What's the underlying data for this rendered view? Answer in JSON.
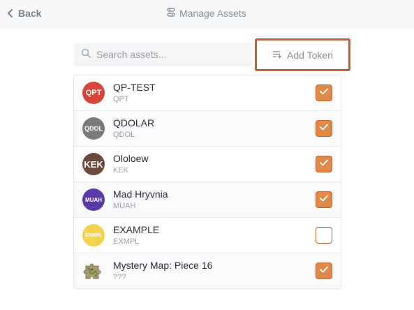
{
  "header": {
    "back_label": "Back",
    "title": "Manage Assets"
  },
  "search": {
    "placeholder": "Search assets...",
    "value": ""
  },
  "add_token": {
    "label": "Add Token"
  },
  "colors": {
    "accent": "#c4602d",
    "checkbox_fill": "#e08a4a"
  },
  "assets": [
    {
      "name": "QP-TEST",
      "symbol": "QPT",
      "avatar_text": "QPT",
      "avatar_color": "#d8453b",
      "checked": true
    },
    {
      "name": "QDOLAR",
      "symbol": "QDOL",
      "avatar_text": "QDOL",
      "avatar_color": "#7a7a7a",
      "checked": true
    },
    {
      "name": "Ololoew",
      "symbol": "KEK",
      "avatar_text": "KEK",
      "avatar_color": "#6b4a3c",
      "checked": true
    },
    {
      "name": "Mad Hryvnia",
      "symbol": "MUAH",
      "avatar_text": "MUAH",
      "avatar_color": "#5b3aa8",
      "checked": true
    },
    {
      "name": "EXAMPLE",
      "symbol": "EXMPL",
      "avatar_text": "EXMPL",
      "avatar_color": "#f2d34f",
      "checked": false
    },
    {
      "name": "Mystery Map: Piece 16",
      "symbol": "???",
      "avatar_text": "",
      "avatar_color": "",
      "checked": true
    }
  ]
}
